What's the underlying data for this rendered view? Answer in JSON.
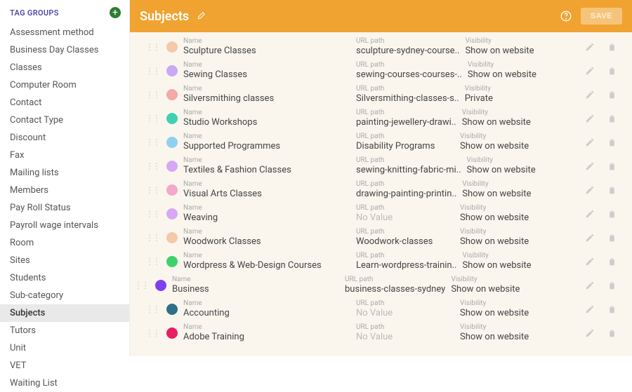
{
  "sidebar": {
    "title": "TAG GROUPS",
    "items": [
      "Assessment method",
      "Business Day Classes",
      "Classes",
      "Computer Room",
      "Contact",
      "Contact Type",
      "Discount",
      "Fax",
      "Mailing lists",
      "Members",
      "Pay Roll Status",
      "Payroll wage intervals",
      "Room",
      "Sites",
      "Students",
      "Sub-category",
      "Subjects",
      "Tutors",
      "Unit",
      "VET",
      "Waiting List"
    ],
    "selected": "Subjects"
  },
  "header": {
    "title": "Subjects",
    "save_label": "SAVE"
  },
  "labels": {
    "name": "Name",
    "url": "URL path",
    "visibility": "Visibility",
    "no_value": "No Value"
  },
  "rows": [
    {
      "indent": 1,
      "color": "#f4c9a8",
      "name": "Sculpture Classes",
      "url": "sculpture-sydney-course..",
      "visibility": "Show on website"
    },
    {
      "indent": 1,
      "color": "#c9a8f4",
      "name": "Sewing Classes",
      "url": "sewing-courses-courses-..",
      "visibility": "Show on website"
    },
    {
      "indent": 1,
      "color": "#f4a8a8",
      "name": "Silversmithing classes",
      "url": "Silversmithing-classes-s..",
      "visibility": "Private"
    },
    {
      "indent": 1,
      "color": "#3fd1b0",
      "name": "Studio Workshops",
      "url": "painting-jewellery-drawi..",
      "visibility": "Show on website"
    },
    {
      "indent": 1,
      "color": "#8fd0ef",
      "name": "Supported Programmes",
      "url": "Disability Programs",
      "visibility": "Show on website"
    },
    {
      "indent": 1,
      "color": "#d6a8f4",
      "name": "Textiles & Fashion Classes",
      "url": "sewing-knitting-fabric-mi..",
      "visibility": "Show on website"
    },
    {
      "indent": 1,
      "color": "#f4a8c9",
      "name": "Visual Arts Classes",
      "url": "drawing-painting-printin..",
      "visibility": "Show on website"
    },
    {
      "indent": 1,
      "color": "#d8a8f4",
      "name": "Weaving",
      "url": null,
      "visibility": "Show on website"
    },
    {
      "indent": 1,
      "color": "#f4c9a8",
      "name": "Woodwork Classes",
      "url": "Woodwork-classes",
      "visibility": "Show on website"
    },
    {
      "indent": 1,
      "color": "#3fd16a",
      "name": "Wordpress & Web-Design Courses",
      "url": "Learn-wordpress-trainin..",
      "visibility": "Show on website"
    },
    {
      "indent": 0,
      "color": "#7e3ff2",
      "name": "Business",
      "url": "business-classes-sydney",
      "visibility": "Show on website"
    },
    {
      "indent": 1,
      "color": "#2e7088",
      "name": "Accounting",
      "url": null,
      "visibility": "Show on website"
    },
    {
      "indent": 1,
      "color": "#e91e63",
      "name": "Adobe Training",
      "url": null,
      "visibility": "Show on website"
    }
  ]
}
